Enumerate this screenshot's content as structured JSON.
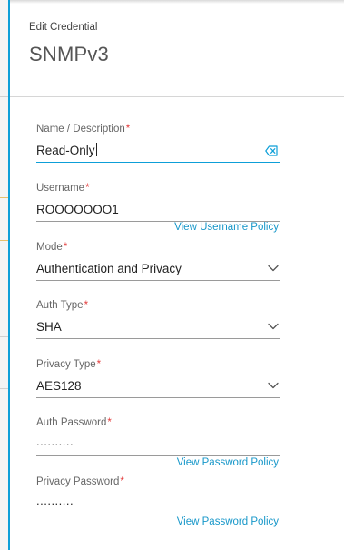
{
  "header": {
    "subtitle": "Edit Credential",
    "title": "SNMPv3"
  },
  "form": {
    "name": {
      "label": "Name / Description",
      "required_mark": "*",
      "value": "Read-Only",
      "clear_icon": "clear-input-icon"
    },
    "username": {
      "label": "Username",
      "required_mark": "*",
      "value": "ROOOOOOO1",
      "policy_link": "View Username Policy"
    },
    "mode": {
      "label": "Mode",
      "required_mark": "*",
      "value": "Authentication and Privacy",
      "icon": "chevron-down-icon"
    },
    "auth_type": {
      "label": "Auth Type",
      "required_mark": "*",
      "value": "SHA",
      "icon": "chevron-down-icon"
    },
    "privacy_type": {
      "label": "Privacy Type",
      "required_mark": "*",
      "value": "AES128",
      "icon": "chevron-down-icon"
    },
    "auth_password": {
      "label": "Auth Password",
      "required_mark": "*",
      "value": "..........",
      "policy_link": "View Password Policy"
    },
    "privacy_password": {
      "label": "Privacy Password",
      "required_mark": "*",
      "value": "..........",
      "policy_link": "View Password Policy"
    }
  },
  "colors": {
    "accent": "#0d9fd8",
    "link": "#1797c9",
    "required": "#e33c3c"
  }
}
